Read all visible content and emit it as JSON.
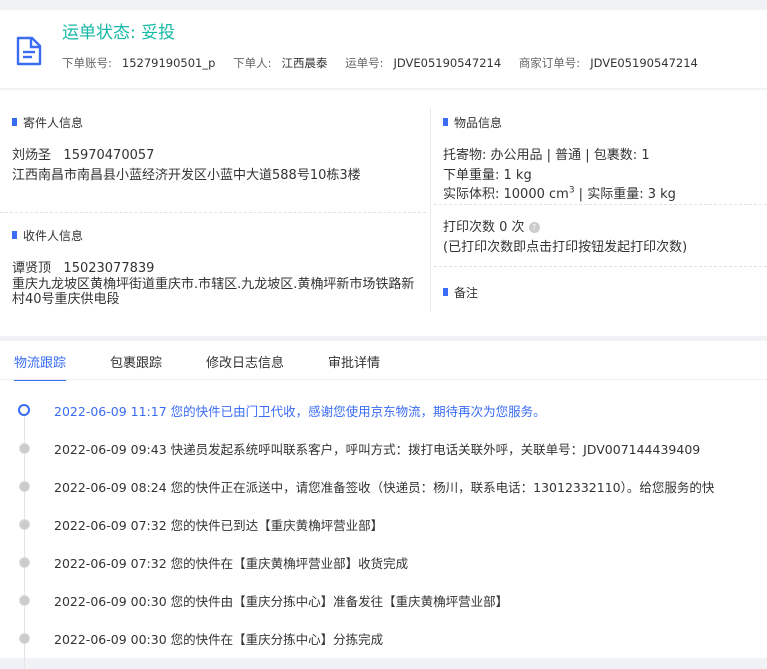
{
  "header": {
    "status": "运单状态: 妥投",
    "meta": [
      {
        "label": "下单账号:",
        "value": "15279190501_p"
      },
      {
        "label": "下单人:",
        "value": "江西晨泰"
      },
      {
        "label": "运单号:",
        "value": "JDVE05190547214"
      },
      {
        "label": "商家订单号:",
        "value": "JDVE05190547214"
      }
    ]
  },
  "sender": {
    "title": "寄件人信息",
    "name": "刘炀圣",
    "phone": "15970470057",
    "address": "江西南昌市南昌县小蓝经济开发区小蓝中大道588号10栋3楼"
  },
  "receiver": {
    "title": "收件人信息",
    "name": "谭贤顶",
    "phone": "15023077839",
    "address": "重庆九龙坡区黄桷坪街道重庆市.市辖区.九龙坡区.黄桷坪新市场铁路新村40号重庆供电段"
  },
  "goods": {
    "title": "物品信息",
    "line1": "托寄物:  办公用品 | 普通  |  包裹数:  1",
    "line2": "下单重量:  1 kg",
    "volume_label": "实际体积:   10000 cm",
    "volume_sup": "3",
    "volume_rest": " | 实际重量:   3 kg",
    "print_label": "打印次数   0 次",
    "print_note": "(已打印次数即点击打印按钮发起打印次数)",
    "remark_title": "备注"
  },
  "tabs": [
    "物流跟踪",
    "包裹跟踪",
    "修改日志信息",
    "审批详情"
  ],
  "timeline": [
    {
      "time": "2022-06-09 11:17",
      "text": "您的快件已由门卫代收，感谢您使用京东物流，期待再次为您服务。"
    },
    {
      "time": "2022-06-09 09:43",
      "text": "快递员发起系统呼叫联系客户，呼叫方式：拨打电话关联外呼，关联单号：JDV007144439409"
    },
    {
      "time": "2022-06-09 08:24",
      "text": "您的快件正在派送中，请您准备签收（快递员：杨川，联系电话：13012332110）。给您服务的快"
    },
    {
      "time": "2022-06-09 07:32",
      "text": "您的快件已到达【重庆黄桷坪营业部】"
    },
    {
      "time": "2022-06-09 07:32",
      "text": "您的快件在【重庆黄桷坪营业部】收货完成"
    },
    {
      "time": "2022-06-09 00:30",
      "text": "您的快件由【重庆分拣中心】准备发往【重庆黄桷坪营业部】"
    },
    {
      "time": "2022-06-09 00:30",
      "text": "您的快件在【重庆分拣中心】分拣完成"
    }
  ],
  "colors": {
    "accent": "#3a6cf4",
    "status": "#16b9a6"
  }
}
